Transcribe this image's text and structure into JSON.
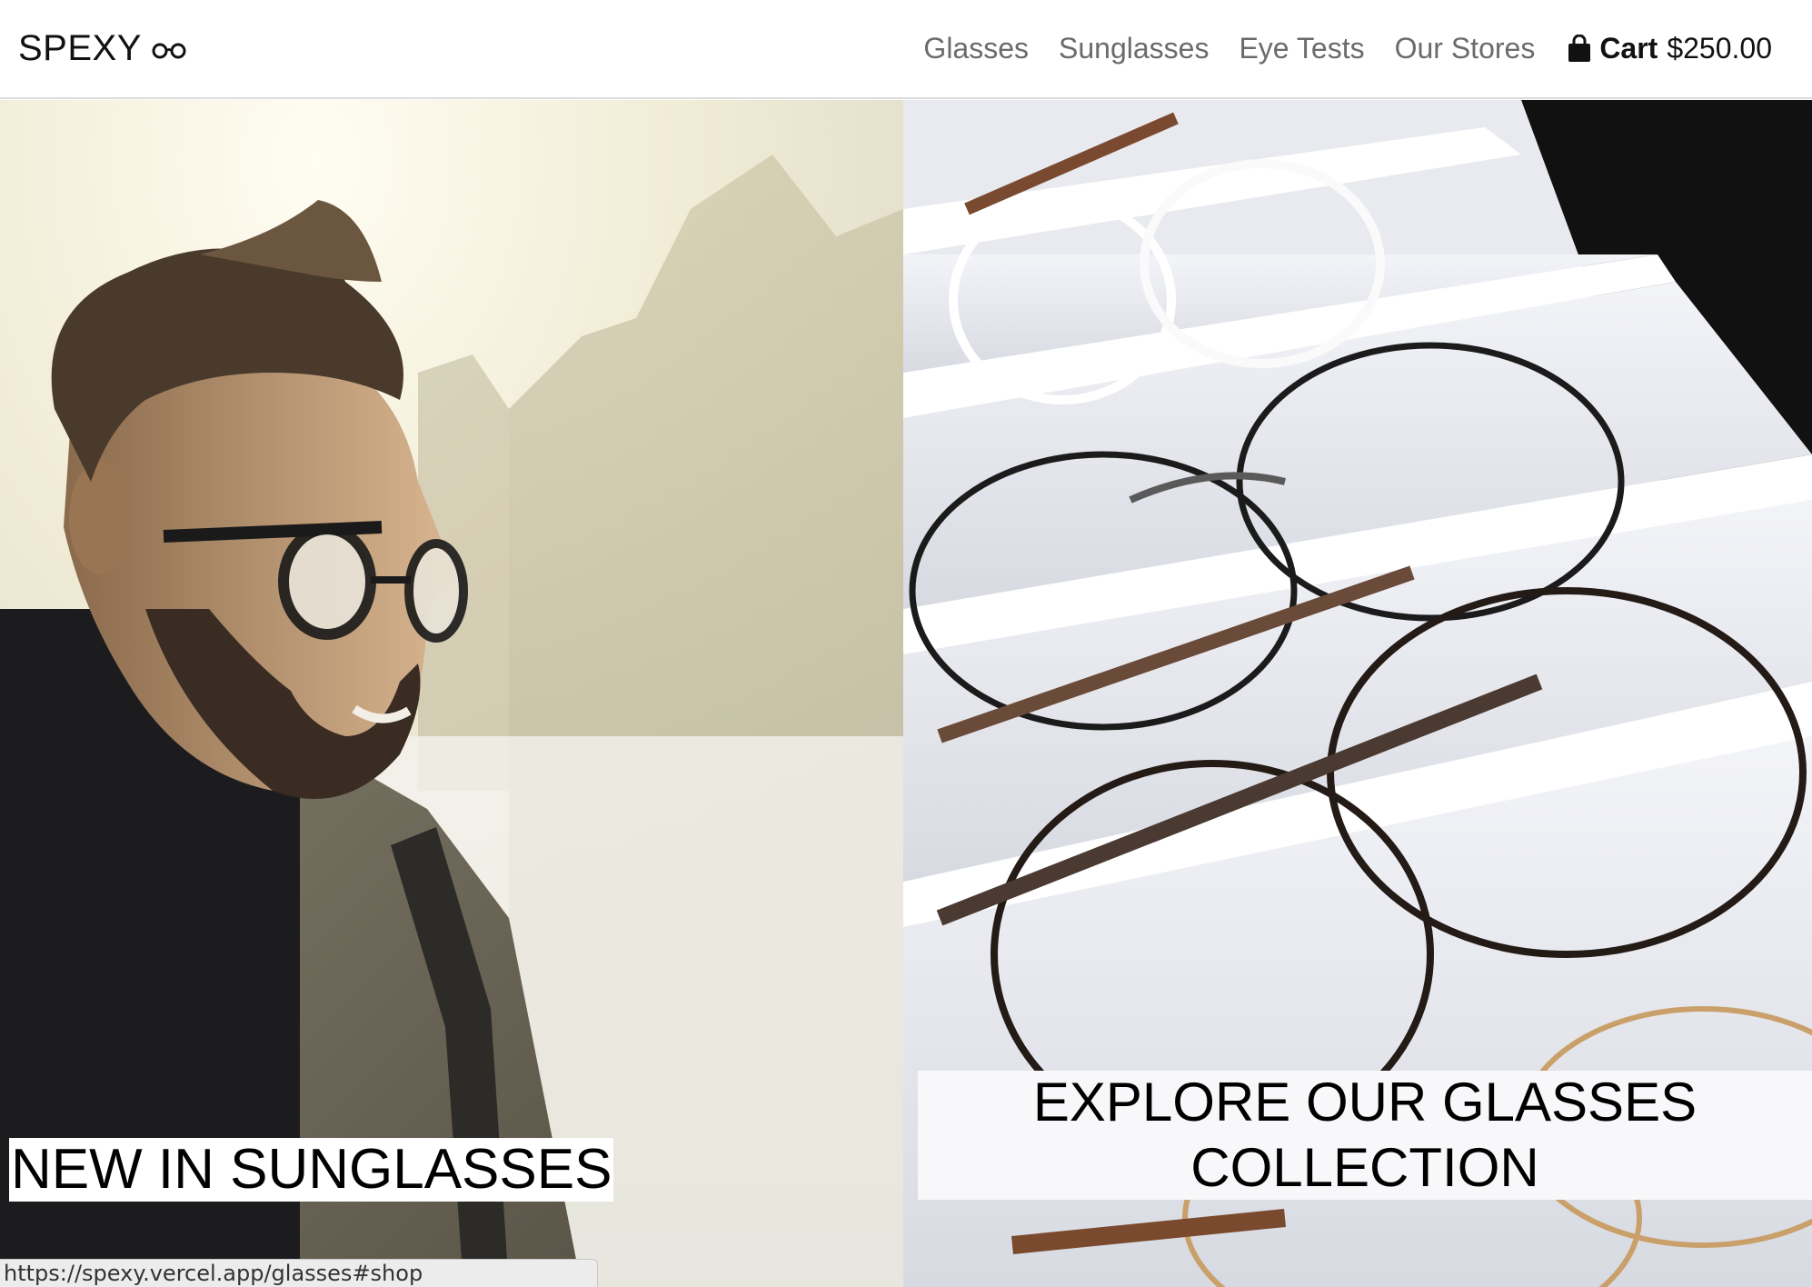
{
  "brand": {
    "name": "SPEXY",
    "icon": "glasses-icon"
  },
  "nav": {
    "links": [
      {
        "label": "Glasses"
      },
      {
        "label": "Sunglasses"
      },
      {
        "label": "Eye Tests"
      },
      {
        "label": "Our Stores"
      }
    ],
    "cart": {
      "icon": "shopping-bag-icon",
      "label": "Cart",
      "total": "$250.00"
    }
  },
  "hero": {
    "left": {
      "label": "NEW IN SUNGLASSES",
      "image": "man-wearing-glasses-photo"
    },
    "right": {
      "label_line1": "EXPLORE OUR GLASSES",
      "label_line2": "COLLECTION",
      "image": "glasses-display-tray-photo"
    }
  },
  "status": {
    "url": "https://spexy.vercel.app/glasses#shop"
  },
  "colors": {
    "nav_text": "#6b6b6b",
    "text": "#111111",
    "header_border": "#dcdcdc"
  }
}
